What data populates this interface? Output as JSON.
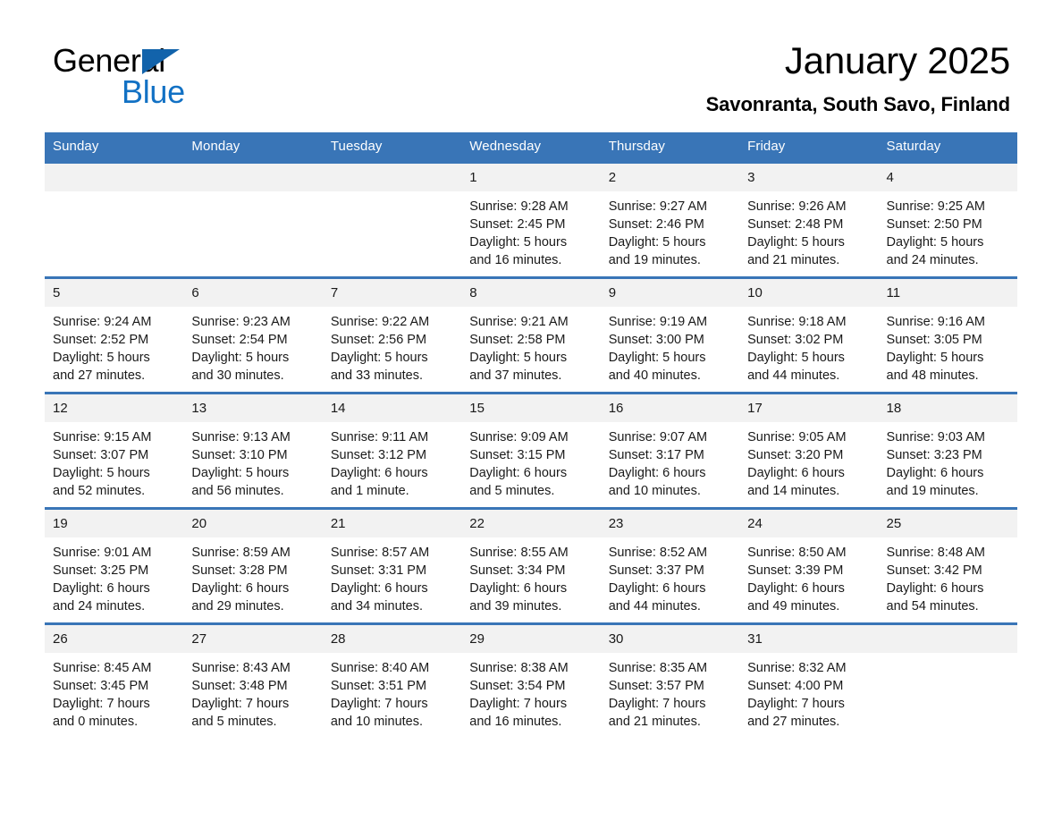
{
  "brand": {
    "name_part1": "General",
    "name_part2": "Blue",
    "triangle_color": "#1263ab",
    "blue_color": "#1271c4"
  },
  "header": {
    "title": "January 2025",
    "subtitle": "Savonranta, South Savo, Finland"
  },
  "theme": {
    "header_blue": "#3975b7",
    "daynum_band": "#f2f2f2",
    "text": "#1a1a1a"
  },
  "calendar": {
    "weekday_headers": [
      "Sunday",
      "Monday",
      "Tuesday",
      "Wednesday",
      "Thursday",
      "Friday",
      "Saturday"
    ],
    "weeks": [
      [
        {
          "day": "",
          "sunrise": "",
          "sunset": "",
          "daylight_line1": "",
          "daylight_line2": ""
        },
        {
          "day": "",
          "sunrise": "",
          "sunset": "",
          "daylight_line1": "",
          "daylight_line2": ""
        },
        {
          "day": "",
          "sunrise": "",
          "sunset": "",
          "daylight_line1": "",
          "daylight_line2": ""
        },
        {
          "day": "1",
          "sunrise": "Sunrise: 9:28 AM",
          "sunset": "Sunset: 2:45 PM",
          "daylight_line1": "Daylight: 5 hours",
          "daylight_line2": "and 16 minutes."
        },
        {
          "day": "2",
          "sunrise": "Sunrise: 9:27 AM",
          "sunset": "Sunset: 2:46 PM",
          "daylight_line1": "Daylight: 5 hours",
          "daylight_line2": "and 19 minutes."
        },
        {
          "day": "3",
          "sunrise": "Sunrise: 9:26 AM",
          "sunset": "Sunset: 2:48 PM",
          "daylight_line1": "Daylight: 5 hours",
          "daylight_line2": "and 21 minutes."
        },
        {
          "day": "4",
          "sunrise": "Sunrise: 9:25 AM",
          "sunset": "Sunset: 2:50 PM",
          "daylight_line1": "Daylight: 5 hours",
          "daylight_line2": "and 24 minutes."
        }
      ],
      [
        {
          "day": "5",
          "sunrise": "Sunrise: 9:24 AM",
          "sunset": "Sunset: 2:52 PM",
          "daylight_line1": "Daylight: 5 hours",
          "daylight_line2": "and 27 minutes."
        },
        {
          "day": "6",
          "sunrise": "Sunrise: 9:23 AM",
          "sunset": "Sunset: 2:54 PM",
          "daylight_line1": "Daylight: 5 hours",
          "daylight_line2": "and 30 minutes."
        },
        {
          "day": "7",
          "sunrise": "Sunrise: 9:22 AM",
          "sunset": "Sunset: 2:56 PM",
          "daylight_line1": "Daylight: 5 hours",
          "daylight_line2": "and 33 minutes."
        },
        {
          "day": "8",
          "sunrise": "Sunrise: 9:21 AM",
          "sunset": "Sunset: 2:58 PM",
          "daylight_line1": "Daylight: 5 hours",
          "daylight_line2": "and 37 minutes."
        },
        {
          "day": "9",
          "sunrise": "Sunrise: 9:19 AM",
          "sunset": "Sunset: 3:00 PM",
          "daylight_line1": "Daylight: 5 hours",
          "daylight_line2": "and 40 minutes."
        },
        {
          "day": "10",
          "sunrise": "Sunrise: 9:18 AM",
          "sunset": "Sunset: 3:02 PM",
          "daylight_line1": "Daylight: 5 hours",
          "daylight_line2": "and 44 minutes."
        },
        {
          "day": "11",
          "sunrise": "Sunrise: 9:16 AM",
          "sunset": "Sunset: 3:05 PM",
          "daylight_line1": "Daylight: 5 hours",
          "daylight_line2": "and 48 minutes."
        }
      ],
      [
        {
          "day": "12",
          "sunrise": "Sunrise: 9:15 AM",
          "sunset": "Sunset: 3:07 PM",
          "daylight_line1": "Daylight: 5 hours",
          "daylight_line2": "and 52 minutes."
        },
        {
          "day": "13",
          "sunrise": "Sunrise: 9:13 AM",
          "sunset": "Sunset: 3:10 PM",
          "daylight_line1": "Daylight: 5 hours",
          "daylight_line2": "and 56 minutes."
        },
        {
          "day": "14",
          "sunrise": "Sunrise: 9:11 AM",
          "sunset": "Sunset: 3:12 PM",
          "daylight_line1": "Daylight: 6 hours",
          "daylight_line2": "and 1 minute."
        },
        {
          "day": "15",
          "sunrise": "Sunrise: 9:09 AM",
          "sunset": "Sunset: 3:15 PM",
          "daylight_line1": "Daylight: 6 hours",
          "daylight_line2": "and 5 minutes."
        },
        {
          "day": "16",
          "sunrise": "Sunrise: 9:07 AM",
          "sunset": "Sunset: 3:17 PM",
          "daylight_line1": "Daylight: 6 hours",
          "daylight_line2": "and 10 minutes."
        },
        {
          "day": "17",
          "sunrise": "Sunrise: 9:05 AM",
          "sunset": "Sunset: 3:20 PM",
          "daylight_line1": "Daylight: 6 hours",
          "daylight_line2": "and 14 minutes."
        },
        {
          "day": "18",
          "sunrise": "Sunrise: 9:03 AM",
          "sunset": "Sunset: 3:23 PM",
          "daylight_line1": "Daylight: 6 hours",
          "daylight_line2": "and 19 minutes."
        }
      ],
      [
        {
          "day": "19",
          "sunrise": "Sunrise: 9:01 AM",
          "sunset": "Sunset: 3:25 PM",
          "daylight_line1": "Daylight: 6 hours",
          "daylight_line2": "and 24 minutes."
        },
        {
          "day": "20",
          "sunrise": "Sunrise: 8:59 AM",
          "sunset": "Sunset: 3:28 PM",
          "daylight_line1": "Daylight: 6 hours",
          "daylight_line2": "and 29 minutes."
        },
        {
          "day": "21",
          "sunrise": "Sunrise: 8:57 AM",
          "sunset": "Sunset: 3:31 PM",
          "daylight_line1": "Daylight: 6 hours",
          "daylight_line2": "and 34 minutes."
        },
        {
          "day": "22",
          "sunrise": "Sunrise: 8:55 AM",
          "sunset": "Sunset: 3:34 PM",
          "daylight_line1": "Daylight: 6 hours",
          "daylight_line2": "and 39 minutes."
        },
        {
          "day": "23",
          "sunrise": "Sunrise: 8:52 AM",
          "sunset": "Sunset: 3:37 PM",
          "daylight_line1": "Daylight: 6 hours",
          "daylight_line2": "and 44 minutes."
        },
        {
          "day": "24",
          "sunrise": "Sunrise: 8:50 AM",
          "sunset": "Sunset: 3:39 PM",
          "daylight_line1": "Daylight: 6 hours",
          "daylight_line2": "and 49 minutes."
        },
        {
          "day": "25",
          "sunrise": "Sunrise: 8:48 AM",
          "sunset": "Sunset: 3:42 PM",
          "daylight_line1": "Daylight: 6 hours",
          "daylight_line2": "and 54 minutes."
        }
      ],
      [
        {
          "day": "26",
          "sunrise": "Sunrise: 8:45 AM",
          "sunset": "Sunset: 3:45 PM",
          "daylight_line1": "Daylight: 7 hours",
          "daylight_line2": "and 0 minutes."
        },
        {
          "day": "27",
          "sunrise": "Sunrise: 8:43 AM",
          "sunset": "Sunset: 3:48 PM",
          "daylight_line1": "Daylight: 7 hours",
          "daylight_line2": "and 5 minutes."
        },
        {
          "day": "28",
          "sunrise": "Sunrise: 8:40 AM",
          "sunset": "Sunset: 3:51 PM",
          "daylight_line1": "Daylight: 7 hours",
          "daylight_line2": "and 10 minutes."
        },
        {
          "day": "29",
          "sunrise": "Sunrise: 8:38 AM",
          "sunset": "Sunset: 3:54 PM",
          "daylight_line1": "Daylight: 7 hours",
          "daylight_line2": "and 16 minutes."
        },
        {
          "day": "30",
          "sunrise": "Sunrise: 8:35 AM",
          "sunset": "Sunset: 3:57 PM",
          "daylight_line1": "Daylight: 7 hours",
          "daylight_line2": "and 21 minutes."
        },
        {
          "day": "31",
          "sunrise": "Sunrise: 8:32 AM",
          "sunset": "Sunset: 4:00 PM",
          "daylight_line1": "Daylight: 7 hours",
          "daylight_line2": "and 27 minutes."
        },
        {
          "day": "",
          "sunrise": "",
          "sunset": "",
          "daylight_line1": "",
          "daylight_line2": ""
        }
      ]
    ]
  }
}
